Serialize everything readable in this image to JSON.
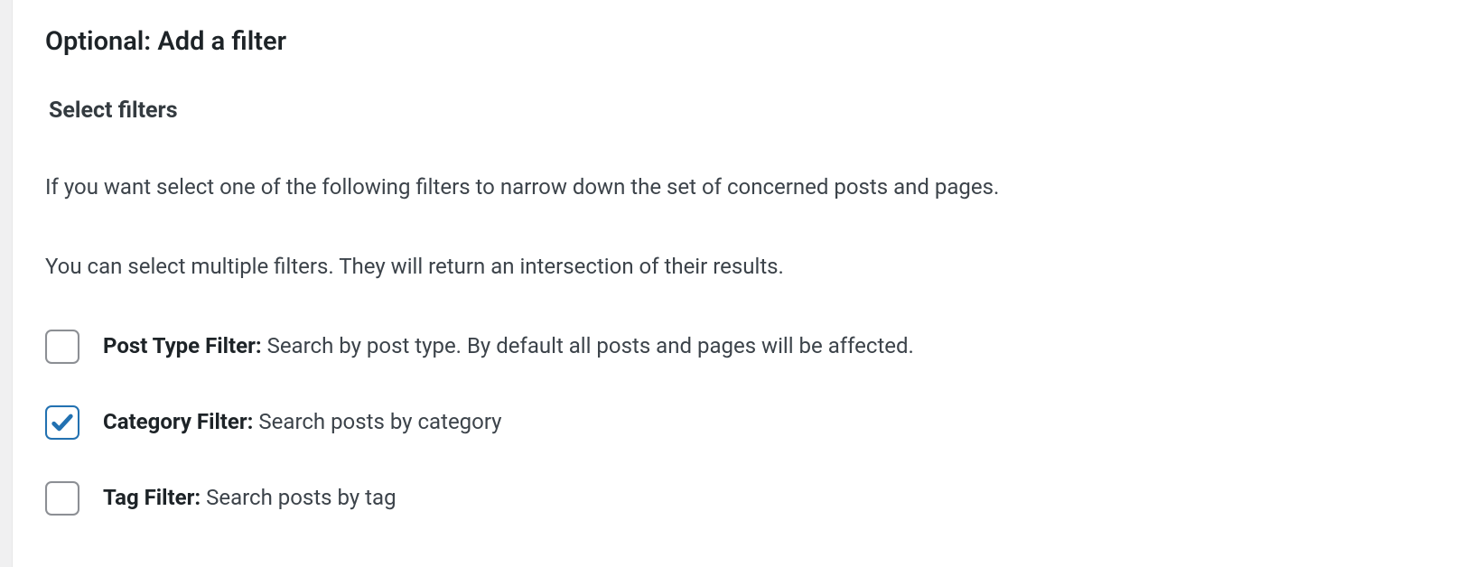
{
  "section": {
    "title": "Optional: Add a filter",
    "subTitle": "Select filters",
    "desc1": "If you want select one of the following filters to narrow down the set of concerned posts and pages.",
    "desc2": "You can select multiple filters. They will return an intersection of their results."
  },
  "filters": [
    {
      "name": "post-type-filter",
      "label": "Post Type Filter:",
      "description": " Search by post type. By default all posts and pages will be affected.",
      "checked": false
    },
    {
      "name": "category-filter",
      "label": "Category Filter:",
      "description": " Search posts by category",
      "checked": true
    },
    {
      "name": "tag-filter",
      "label": "Tag Filter:",
      "description": " Search posts by tag",
      "checked": false
    }
  ]
}
